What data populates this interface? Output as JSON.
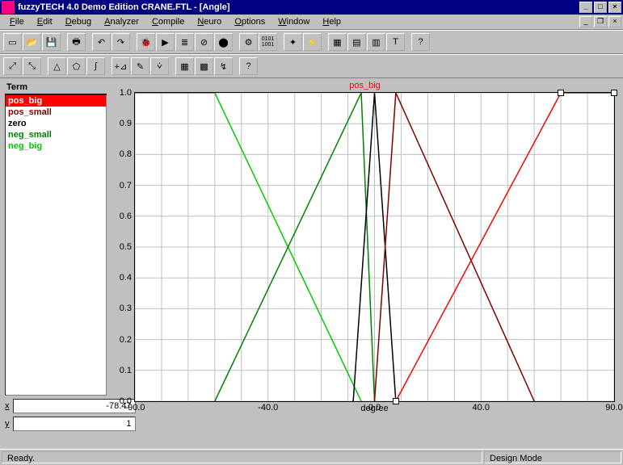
{
  "title": "fuzzyTECH 4.0 Demo Edition  CRANE.FTL - [Angle]",
  "menu": [
    "File",
    "Edit",
    "Debug",
    "Analyzer",
    "Compile",
    "Neuro",
    "Options",
    "Window",
    "Help"
  ],
  "term_header": "Term",
  "terms": [
    {
      "label": "pos_big",
      "color": "#ff0000",
      "selected": true
    },
    {
      "label": "pos_small",
      "color": "#800000",
      "selected": false
    },
    {
      "label": "zero",
      "color": "#000000",
      "selected": false
    },
    {
      "label": "neg_small",
      "color": "#008000",
      "selected": false
    },
    {
      "label": "neg_big",
      "color": "#00cc00",
      "selected": false
    }
  ],
  "x_field": {
    "label": "x",
    "value": "-78.47"
  },
  "y_field": {
    "label": "y",
    "value": "1"
  },
  "chart_title": "pos_big",
  "x_axis_label": "degree",
  "status_left": "Ready.",
  "status_right": "Design Mode",
  "chart_data": {
    "type": "line",
    "xlabel": "degree",
    "ylabel": "",
    "xlim": [
      -90,
      90
    ],
    "ylim": [
      0,
      1.0
    ],
    "xticks": [
      -90.0,
      -40.0,
      0.0,
      40.0,
      90.0
    ],
    "yticks": [
      0.0,
      0.1,
      0.2,
      0.3,
      0.4,
      0.5,
      0.6,
      0.7,
      0.8,
      0.9,
      1.0
    ],
    "series": [
      {
        "name": "neg_big",
        "color": "#00cc00",
        "points": [
          [
            -90,
            1.0
          ],
          [
            -60,
            1.0
          ],
          [
            -5,
            0.0
          ]
        ]
      },
      {
        "name": "neg_small",
        "color": "#008000",
        "points": [
          [
            -60,
            0.0
          ],
          [
            -5,
            1.0
          ],
          [
            0,
            0.0
          ]
        ]
      },
      {
        "name": "zero",
        "color": "#000000",
        "points": [
          [
            -8,
            0.0
          ],
          [
            0,
            1.0
          ],
          [
            8,
            0.0
          ]
        ]
      },
      {
        "name": "pos_small",
        "color": "#800000",
        "points": [
          [
            0,
            0.0
          ],
          [
            8,
            1.0
          ],
          [
            60,
            0.0
          ]
        ]
      },
      {
        "name": "pos_big",
        "color": "#ff0000",
        "points": [
          [
            8,
            0.0
          ],
          [
            70,
            1.0
          ],
          [
            90,
            1.0
          ]
        ]
      }
    ],
    "handles": [
      [
        8,
        0.0
      ],
      [
        70,
        1.0
      ],
      [
        90,
        1.0
      ]
    ]
  }
}
